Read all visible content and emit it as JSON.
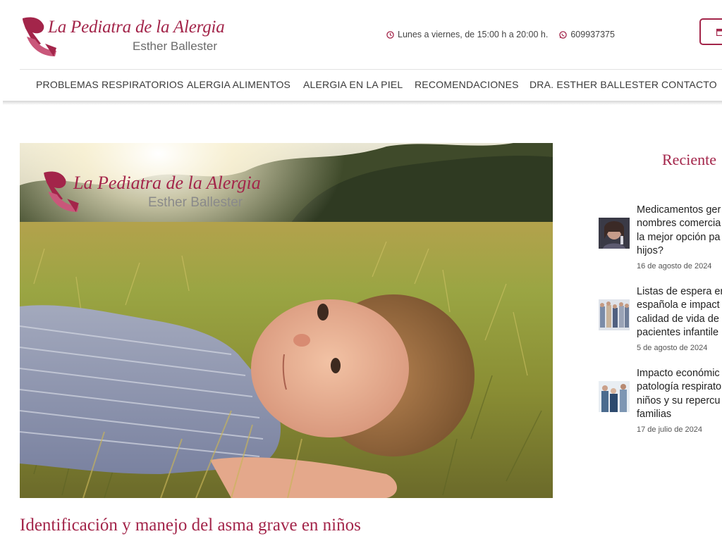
{
  "header": {
    "logo_title": "La Pediatra de la Alergia",
    "logo_subtitle": "Esther Ballester",
    "hours": "Lunes a viernes, de 15:00 h a 20:00 h.",
    "phone": "609937375",
    "cta_icon": "calendar-icon"
  },
  "nav": {
    "items": [
      {
        "label": "PROBLEMAS RESPIRATORIOS"
      },
      {
        "label": "ALERGIA ALIMENTOS"
      },
      {
        "label": "ALERGIA EN LA PIEL"
      },
      {
        "label": "RECOMENDACIONES"
      },
      {
        "label": "DRA. ESTHER BALLESTER"
      },
      {
        "label": "CONTACTO"
      }
    ]
  },
  "hero": {
    "overlay_title": "La Pediatra de la Alergia",
    "overlay_subtitle": "Esther Ballester"
  },
  "post": {
    "title": "Identificación y manejo del asma grave en niños"
  },
  "sidebar": {
    "title": "Reciente",
    "posts": [
      {
        "lines": [
          "Medicamentos ger",
          "nombres comercia",
          "la mejor opción pa",
          "hijos?"
        ],
        "date": "16 de agosto de 2024"
      },
      {
        "lines": [
          "Listas de espera er",
          "española e impact",
          "calidad de vida de",
          "pacientes infantile"
        ],
        "date": "5 de agosto de 2024"
      },
      {
        "lines": [
          "Impacto económic",
          "patología respirato",
          "niños y su repercu",
          "familias"
        ],
        "date": "17 de julio de 2024"
      }
    ]
  },
  "colors": {
    "brand": "#a3254a",
    "text": "#333333"
  }
}
